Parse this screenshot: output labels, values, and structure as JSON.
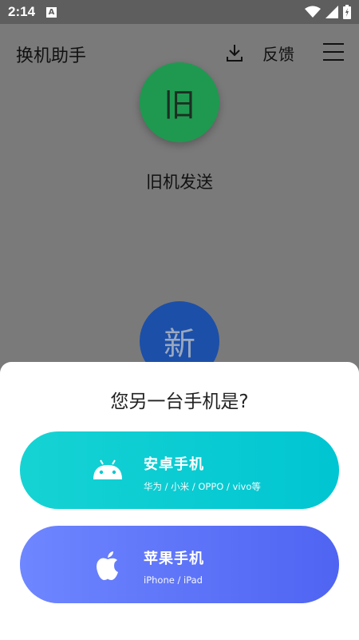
{
  "status": {
    "time": "2:14",
    "a_badge": "A"
  },
  "header": {
    "title": "换机助手",
    "feedback": "反馈"
  },
  "main": {
    "old_phone": {
      "glyph": "旧",
      "label": "旧机发送"
    },
    "new_phone": {
      "glyph": "新"
    }
  },
  "sheet": {
    "title": "您另一台手机是?",
    "options": [
      {
        "name": "安卓手机",
        "sub": "华为 / 小米 / OPPO / vivo等",
        "icon": "android-icon"
      },
      {
        "name": "苹果手机",
        "sub": "iPhone / iPad",
        "icon": "apple-icon"
      }
    ]
  },
  "colors": {
    "old_circle": "#1f9950",
    "new_circle": "#1c4fa8",
    "android_button": "#00c9d4",
    "ios_button": "#5b70f5"
  }
}
